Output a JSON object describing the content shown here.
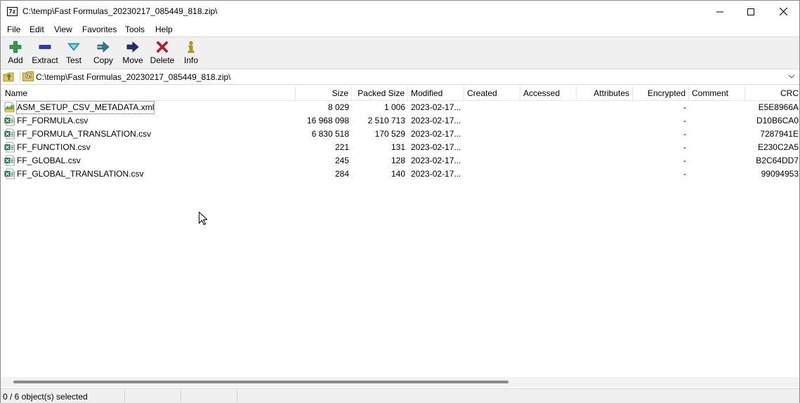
{
  "window": {
    "title": "C:\\temp\\Fast Formulas_20230217_085449_818.zip\\",
    "app_icon_text": "7z",
    "controls": [
      "minimize-icon",
      "maximize-icon",
      "close-icon"
    ]
  },
  "menu": {
    "items": [
      "File",
      "Edit",
      "View",
      "Favorites",
      "Tools",
      "Help"
    ]
  },
  "toolbar": {
    "buttons": [
      {
        "label": "Add",
        "icon": "plus-icon",
        "color": "#2ea043"
      },
      {
        "label": "Extract",
        "icon": "minus-icon",
        "color": "#1f3fbf"
      },
      {
        "label": "Test",
        "icon": "check-icon",
        "color": "#1aa6c8"
      },
      {
        "label": "Copy",
        "icon": "double-arrow-right-icon",
        "color": "#2f7d8c"
      },
      {
        "label": "Move",
        "icon": "arrow-right-icon",
        "color": "#1f2f7a"
      },
      {
        "label": "Delete",
        "icon": "x-icon",
        "color": "#d0181b"
      },
      {
        "label": "Info",
        "icon": "info-icon",
        "color": "#c89a00"
      }
    ]
  },
  "address": {
    "value": "C:\\temp\\Fast Formulas_20230217_085449_818.zip\\"
  },
  "columns": [
    "Name",
    "Size",
    "Packed Size",
    "Modified",
    "Created",
    "Accessed",
    "Attributes",
    "Encrypted",
    "Comment",
    "CRC"
  ],
  "files": [
    {
      "name": "ASM_SETUP_CSV_METADATA.xml",
      "type": "xml",
      "size": "8 029",
      "packed": "1 006",
      "modified": "2023-02-17...",
      "created": "",
      "accessed": "",
      "attributes": "",
      "encrypted": "-",
      "comment": "",
      "crc": "E5E8966A"
    },
    {
      "name": "FF_FORMULA.csv",
      "type": "csv",
      "size": "16 968 098",
      "packed": "2 510 713",
      "modified": "2023-02-17...",
      "created": "",
      "accessed": "",
      "attributes": "",
      "encrypted": "-",
      "comment": "",
      "crc": "D10B6CA0"
    },
    {
      "name": "FF_FORMULA_TRANSLATION.csv",
      "type": "csv",
      "size": "6 830 518",
      "packed": "170 529",
      "modified": "2023-02-17...",
      "created": "",
      "accessed": "",
      "attributes": "",
      "encrypted": "-",
      "comment": "",
      "crc": "7287941E"
    },
    {
      "name": "FF_FUNCTION.csv",
      "type": "csv",
      "size": "221",
      "packed": "131",
      "modified": "2023-02-17...",
      "created": "",
      "accessed": "",
      "attributes": "",
      "encrypted": "-",
      "comment": "",
      "crc": "E230C2A5"
    },
    {
      "name": "FF_GLOBAL.csv",
      "type": "csv",
      "size": "245",
      "packed": "128",
      "modified": "2023-02-17...",
      "created": "",
      "accessed": "",
      "attributes": "",
      "encrypted": "-",
      "comment": "",
      "crc": "B2C64DD7"
    },
    {
      "name": "FF_GLOBAL_TRANSLATION.csv",
      "type": "csv",
      "size": "284",
      "packed": "140",
      "modified": "2023-02-17...",
      "created": "",
      "accessed": "",
      "attributes": "",
      "encrypted": "-",
      "comment": "",
      "crc": "99094953"
    }
  ],
  "status": {
    "text": "0 / 6 object(s) selected"
  }
}
